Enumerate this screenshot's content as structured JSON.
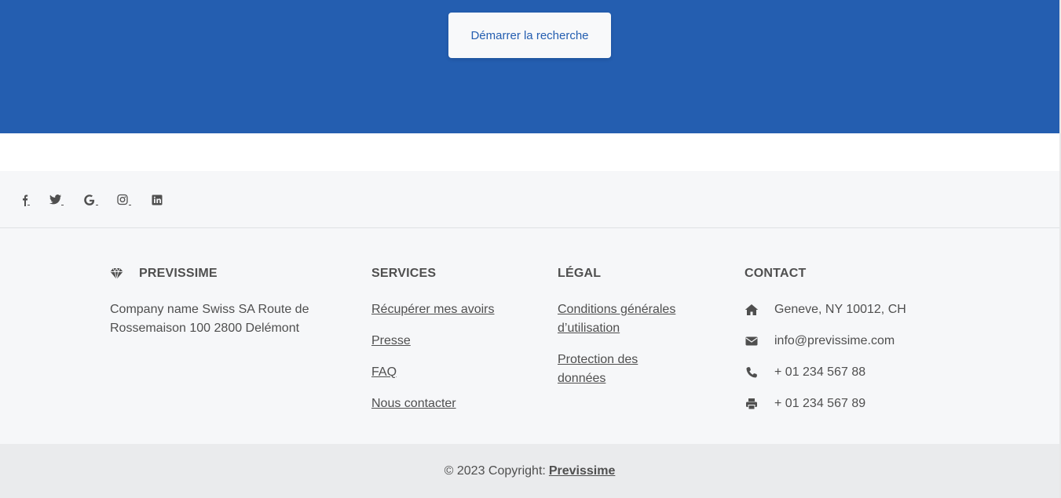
{
  "hero": {
    "button_label": "Démarrer la recherche"
  },
  "social": {
    "icons": [
      "facebook-icon",
      "twitter-icon",
      "google-icon",
      "instagram-icon",
      "linkedin-icon"
    ]
  },
  "brand": {
    "name": "PREVISSIME",
    "address": "Company name Swiss SA Route de Rossemaison 100 2800 Delémont"
  },
  "services": {
    "title": "SERVICES",
    "links": [
      "Récupérer mes avoirs",
      "Presse",
      "FAQ",
      "Nous contacter"
    ]
  },
  "legal": {
    "title": "LÉGAL",
    "links": [
      "Conditions générales d’utilisation",
      "Protection des données"
    ]
  },
  "contact": {
    "title": "CONTACT",
    "address": "Geneve, NY 10012, CH",
    "email": "info@previssime.com",
    "phone": "+ 01 234 567 88",
    "fax": "+ 01 234 567 89"
  },
  "copyright": {
    "text": "© 2023 Copyright:",
    "link": "Previssime"
  },
  "colors": {
    "brand_blue": "#245eb0",
    "footer_bg": "#f6f7f9",
    "copyright_bg": "#eaebed",
    "text": "#4f4f4f"
  }
}
